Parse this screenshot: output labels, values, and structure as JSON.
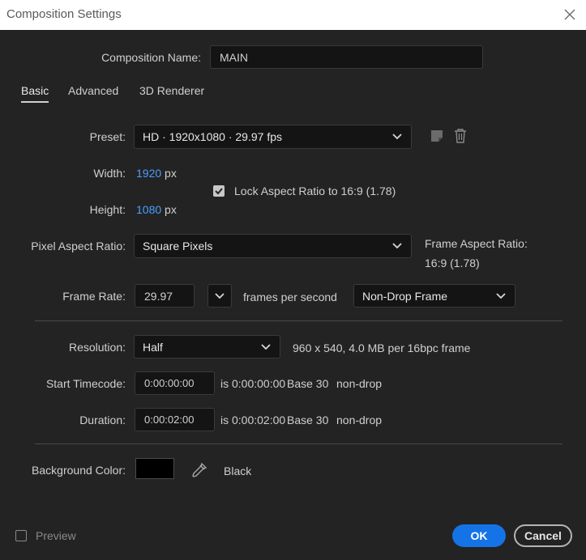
{
  "window": {
    "title": "Composition Settings"
  },
  "composition_name": {
    "label": "Composition Name:",
    "value": "MAIN"
  },
  "tabs": [
    {
      "label": "Basic",
      "active": true
    },
    {
      "label": "Advanced",
      "active": false
    },
    {
      "label": "3D Renderer",
      "active": false
    }
  ],
  "preset": {
    "label": "Preset:",
    "value": "HD  ·  1920x1080 · 29.97 fps"
  },
  "width": {
    "label": "Width:",
    "value": "1920",
    "unit": "px"
  },
  "height": {
    "label": "Height:",
    "value": "1080",
    "unit": "px"
  },
  "lock_aspect": {
    "label": "Lock Aspect Ratio to 16:9 (1.78)",
    "checked": true
  },
  "pixel_aspect": {
    "label": "Pixel Aspect Ratio:",
    "value": "Square Pixels"
  },
  "frame_aspect": {
    "label": "Frame Aspect Ratio:",
    "value": "16:9 (1.78)"
  },
  "frame_rate": {
    "label": "Frame Rate:",
    "value": "29.97",
    "unit_label": "frames per second",
    "drop_mode": "Non-Drop Frame"
  },
  "resolution": {
    "label": "Resolution:",
    "value": "Half",
    "info": "960 x 540, 4.0 MB per 16bpc frame"
  },
  "start_timecode": {
    "label": "Start Timecode:",
    "value": "0:00:00:00",
    "is_text": "is 0:00:00:00",
    "base": "Base 30",
    "mode": "non-drop"
  },
  "duration": {
    "label": "Duration:",
    "value": "0:00:02:00",
    "is_text": "is 0:00:02:00",
    "base": "Base 30",
    "mode": "non-drop"
  },
  "background": {
    "label": "Background Color:",
    "color": "#000000",
    "name": "Black"
  },
  "preview": {
    "label": "Preview",
    "checked": false
  },
  "buttons": {
    "ok": "OK",
    "cancel": "Cancel"
  },
  "colors": {
    "accent": "#1473e6",
    "value_blue": "#4a9fff",
    "panel": "#232323",
    "field": "#141414"
  }
}
